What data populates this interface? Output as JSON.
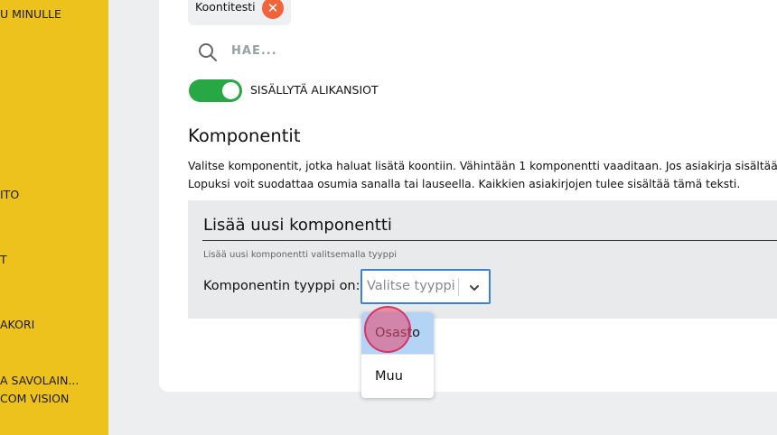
{
  "sidebar": {
    "items": [
      {
        "label": "U MINULLE"
      },
      {
        "label": "ITO"
      },
      {
        "label": "T"
      },
      {
        "label": "AKORI"
      },
      {
        "label": "A SAVOLAIN..."
      },
      {
        "label": "COM VISION"
      }
    ]
  },
  "filter": {
    "tag_label": "Koontitesti",
    "tag_remove_glyph": "✕",
    "search_placeholder": "HAE...",
    "toggle_label": "SISÄLLYTÄ ALIKANSIOT",
    "toggle_on": true
  },
  "components": {
    "title": "Komponentit",
    "desc_line1": "Valitse komponentit, jotka haluat lisätä koontiin. Vähintään 1 komponentti vaaditaan. Jos asiakirja sisältää m",
    "desc_line2": "Lopuksi voit suodattaa osumia sanalla tai lauseella. Kaikkien asiakirjojen tulee sisältää tämä teksti.",
    "add_title": "Lisää uusi komponentti",
    "add_hint": "Lisää uusi komponentti valitsemalla tyyppi",
    "type_label": "Komponentin tyyppi on:",
    "select_placeholder": "Valitse tyyppi",
    "options": [
      {
        "label": "Osasto"
      },
      {
        "label": "Muu"
      }
    ]
  },
  "colors": {
    "sidebar": "#eec21c",
    "accent": "#28a745",
    "select_border": "#3b82d6",
    "option_highlight": "#b4d4f5",
    "remove_tag": "#f0643c"
  }
}
